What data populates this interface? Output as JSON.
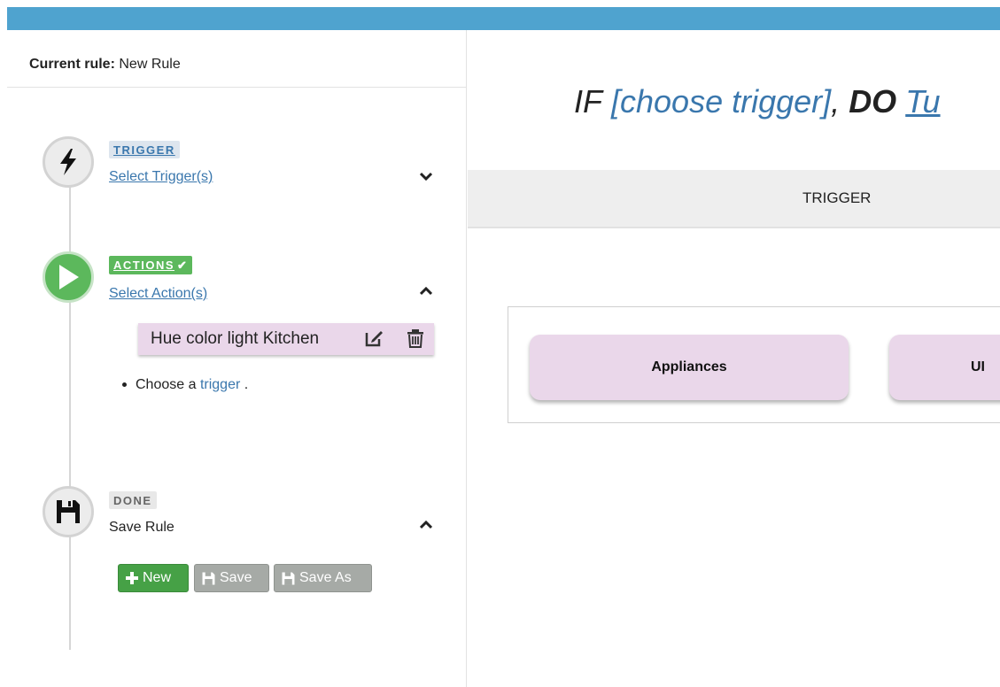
{
  "colors": {
    "topbar": "#4fa3cf",
    "link": "#3a77ad",
    "green": "#5cb85c",
    "action_bg": "#ead7ea",
    "button_grey": "#a6aaa6"
  },
  "sidebar": {
    "current_rule_label": "Current rule:",
    "current_rule_value": "New Rule",
    "steps": [
      {
        "badge": "TRIGGER",
        "link": "Select Trigger(s)",
        "icon": "bolt-icon",
        "chevron": "chevron-down-icon"
      },
      {
        "badge": "ACTIONS",
        "badge_check": "✔",
        "link": "Select Action(s)",
        "icon": "play-icon",
        "chevron": "chevron-up-icon"
      },
      {
        "badge": "DONE",
        "text": "Save Rule",
        "icon": "floppy-disk-icon",
        "chevron": "chevron-up-icon"
      }
    ],
    "action_item": {
      "label": "Hue color light Kitchen",
      "edit_icon": "edit-icon",
      "delete_icon": "trash-icon"
    },
    "hint": {
      "prefix": "Choose a",
      "link": "trigger",
      "suffix": "."
    },
    "buttons": {
      "new": "New",
      "save": "Save",
      "save_as": "Save As"
    }
  },
  "main": {
    "title": {
      "if": "IF",
      "trigger": "[choose trigger]",
      "comma": ",",
      "do": "DO",
      "action": "Tu"
    },
    "tab": "TRIGGER",
    "categories": [
      "Appliances",
      "UI"
    ]
  }
}
